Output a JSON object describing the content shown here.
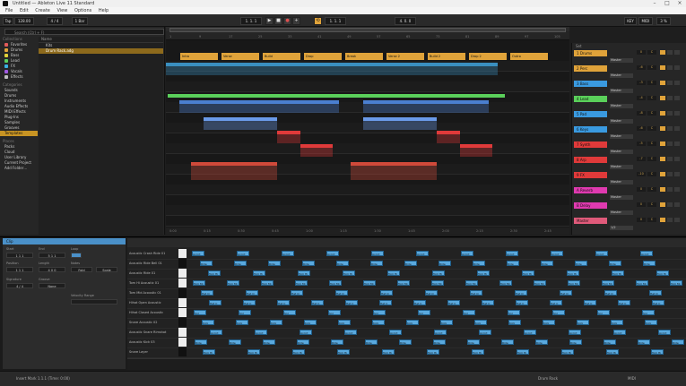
{
  "window": {
    "title": "Untitled — Ableton Live 11 Standard"
  },
  "menu": [
    "File",
    "Edit",
    "Create",
    "View",
    "Options",
    "Help"
  ],
  "transport": {
    "tap": "Tap",
    "tempo": "128.00",
    "signature": "4 / 4",
    "metro": "1 Bar",
    "position": "1. 1. 1",
    "loop_start": "1. 1. 1",
    "loop_length": "4. 0. 0",
    "key_label": "KEY",
    "midi_label": "MIDI",
    "cpu": "3 %"
  },
  "browser": {
    "search_placeholder": "Search (Ctrl + F)",
    "collections_label": "Collections",
    "categories_label": "Categories",
    "places_label": "Places",
    "collections": [
      {
        "label": "Favorites",
        "color": "#e05a5a"
      },
      {
        "label": "Drums",
        "color": "#e0a33a"
      },
      {
        "label": "Bass",
        "color": "#e0d03a"
      },
      {
        "label": "Lead",
        "color": "#5ad05a"
      },
      {
        "label": "FX",
        "color": "#3ab0e0"
      },
      {
        "label": "Vocals",
        "color": "#a05ae0"
      },
      {
        "label": "Effects",
        "color": "#c0c0c0"
      }
    ],
    "categories": [
      "Sounds",
      "Drums",
      "Instruments",
      "Audio Effects",
      "MIDI Effects",
      "Plug-Ins",
      "Samples",
      "Grooves",
      "Templates"
    ],
    "places": [
      "Packs",
      "Cloud",
      "User Library",
      "Current Project",
      "Add Folder…"
    ],
    "list_header": "Name",
    "files": [
      "Kits",
      "Drum Rack.adg"
    ]
  },
  "arrangement": {
    "ruler": [
      "1",
      "9",
      "17",
      "25",
      "33",
      "41",
      "49",
      "57",
      "65",
      "73",
      "81",
      "89",
      "97",
      "105"
    ],
    "time_ruler": [
      "0:00",
      "0:15",
      "0:30",
      "0:45",
      "1:00",
      "1:15",
      "1:30",
      "1:45",
      "2:00",
      "2:15",
      "2:30",
      "2:45"
    ],
    "locators": [
      "Intro",
      "Verse",
      "Build",
      "Drop",
      "Break",
      "Verse 2",
      "Build 2",
      "Drop 2",
      "Outro"
    ]
  },
  "mixer": {
    "header": "Set",
    "tracks": [
      {
        "name": "1 Drums",
        "color": "#e0a33a",
        "vol": "0",
        "pan": "C",
        "send": "Master"
      },
      {
        "name": "2 Perc",
        "color": "#e0a33a",
        "vol": "-6",
        "pan": "C",
        "send": "Master"
      },
      {
        "name": "3 Bass",
        "color": "#3a9ae0",
        "vol": "-3",
        "pan": "C",
        "send": "Master"
      },
      {
        "name": "4 Lead",
        "color": "#5ad05a",
        "vol": "-4",
        "pan": "C",
        "send": "Master"
      },
      {
        "name": "5 Pad",
        "color": "#3a9ae0",
        "vol": "-8",
        "pan": "C",
        "send": "Master"
      },
      {
        "name": "6 Keys",
        "color": "#3a9ae0",
        "vol": "-6",
        "pan": "C",
        "send": "Master"
      },
      {
        "name": "7 Synth",
        "color": "#e03a3a",
        "vol": "-5",
        "pan": "C",
        "send": "Master"
      },
      {
        "name": "8 Arp",
        "color": "#e03a3a",
        "vol": "-7",
        "pan": "C",
        "send": "Master"
      },
      {
        "name": "9 FX",
        "color": "#e03a3a",
        "vol": "-10",
        "pan": "C",
        "send": "Master"
      },
      {
        "name": "A Reverb",
        "color": "#e03ab0",
        "vol": "0",
        "pan": "C",
        "send": "Master"
      },
      {
        "name": "B Delay",
        "color": "#e03ab0",
        "vol": "0",
        "pan": "C",
        "send": "Master"
      },
      {
        "name": "Master",
        "color": "#e05a7a",
        "vol": "0",
        "pan": "C",
        "send": "1/2"
      }
    ]
  },
  "clip_view": {
    "title": "Clip",
    "start_label": "Start",
    "start": "1 1 1",
    "end_label": "End",
    "end": "5 1 1",
    "loop_label": "Loop",
    "position_label": "Position",
    "length_label": "Length",
    "position": "1 1 1",
    "length": "4 0 0",
    "signature_label": "Signature",
    "signature": "4 / 4",
    "groove_label": "Groove",
    "groove": "None",
    "notes_label": "Notes",
    "fold_label": "Fold",
    "scale_label": "Scale",
    "velocity_label": "Velocity Range"
  },
  "drum_rows": [
    "Acoustic Crash Ride 01",
    "Acoustic Ride Bell 01",
    "Acoustic Ride 01",
    "Tom Hi Acoustic 01",
    "Tom Mid Acoustic 01",
    "Hihat Open Acoustic",
    "Hihat Closed Acoustic",
    "Snare Acoustic 02",
    "Acoustic Snare Rimshot",
    "Acoustic Kick 03",
    "Snare Layer"
  ],
  "note_labels": [
    "Accnt",
    "Ride",
    "Tom Hi",
    "Tom Mi",
    "Hat O",
    "Hat C",
    "Snr",
    "Kick"
  ],
  "status": {
    "left": "Insert Mark 1.1.1 (Time: 0:00)",
    "right": "Drum Rack",
    "midi": "MIDI"
  }
}
